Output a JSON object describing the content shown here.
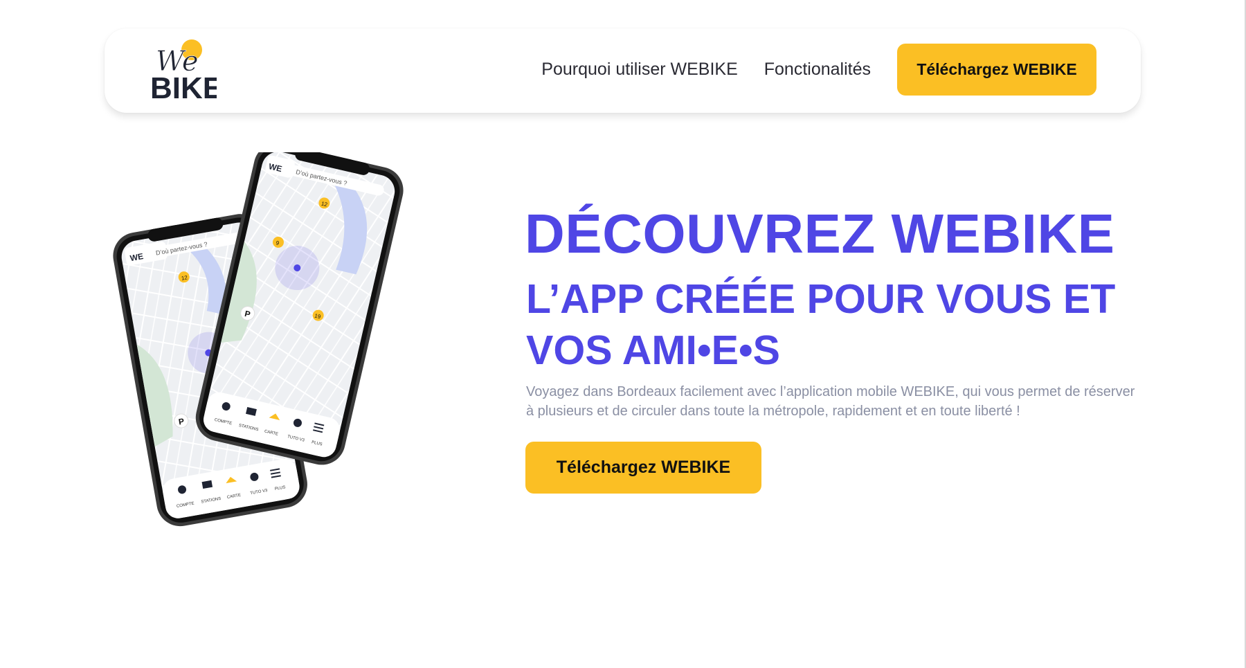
{
  "brand": {
    "logo_top": "We",
    "logo_bottom": "BIKE",
    "primary_color": "#4f46e5",
    "accent_color": "#fbbf24"
  },
  "nav": {
    "links": [
      "Pourquoi utiliser WEBIKE",
      "Fonctionalités"
    ],
    "cta": "Téléchargez WEBIKE"
  },
  "hero": {
    "title": "DÉCOUVREZ WEBIKE",
    "subtitle": "L’APP CRÉÉE POUR VOUS ET VOS AMI•E•S",
    "description": "Voyagez dans Bordeaux facilement avec l’application mobile WEBIKE, qui vous permet de réserver à plusieurs et de circuler dans toute la métropole, rapidement et en toute liberté !",
    "cta": "Téléchargez WEBIKE"
  },
  "phone_app": {
    "search_placeholder": "D’où partez-vous ?",
    "station_counts": [
      "12",
      "9",
      "19",
      "2"
    ],
    "tab_labels": [
      "COMPTE",
      "STATIONS",
      "CARTE",
      "TUTO V3",
      "PLUS"
    ]
  }
}
